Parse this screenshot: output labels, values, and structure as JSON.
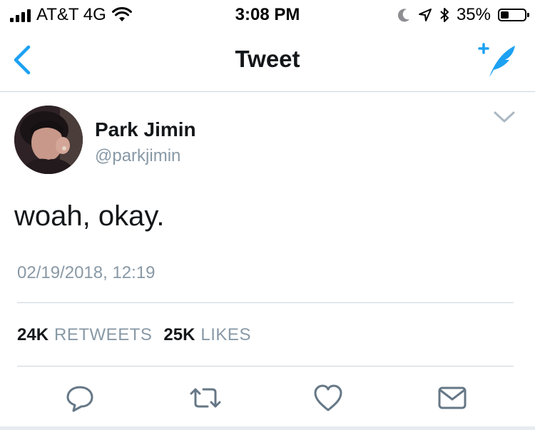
{
  "status_bar": {
    "carrier": "AT&T 4G",
    "time": "3:08 PM",
    "battery_percent": "35%",
    "battery_level": 0.35,
    "icons": [
      "signal-bars-icon",
      "wifi-icon",
      "moon-icon",
      "location-arrow-icon",
      "bluetooth-icon",
      "battery-icon"
    ]
  },
  "nav": {
    "title": "Tweet",
    "back_icon": "chevron-left-icon",
    "compose_icon": "compose-feather-icon"
  },
  "tweet": {
    "display_name": "Park Jimin",
    "handle": "@parkjimin",
    "text": "woah, okay.",
    "timestamp": "02/19/2018, 12:19",
    "more_icon": "chevron-down-icon"
  },
  "stats": {
    "retweets_count": "24K",
    "retweets_label": "RETWEETS",
    "likes_count": "25K",
    "likes_label": "LIKES"
  },
  "actions": {
    "icons": [
      "reply-icon",
      "retweet-icon",
      "like-heart-icon",
      "direct-message-icon"
    ]
  },
  "colors": {
    "accent": "#1da1f2",
    "text_primary": "#14171a",
    "text_secondary": "#8899a6",
    "divider": "#ccd6dd"
  }
}
